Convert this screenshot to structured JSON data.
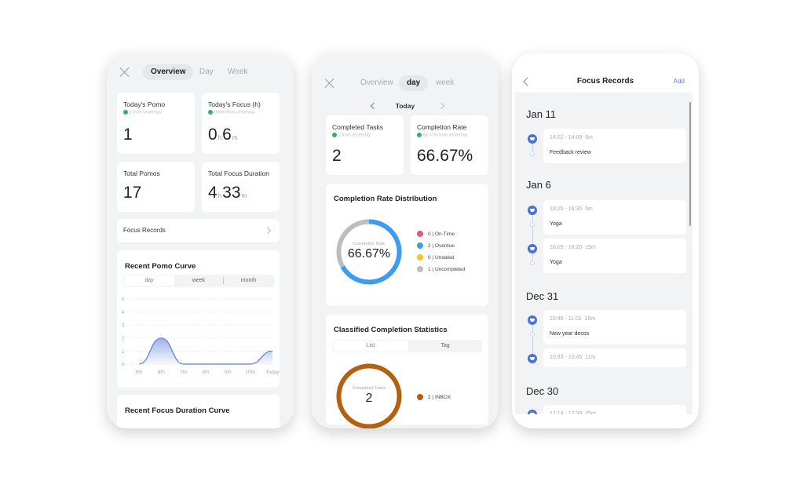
{
  "screen1": {
    "tabs": [
      "Overview",
      "Day",
      "Week"
    ],
    "active_tab": "Overview",
    "stats": [
      {
        "title": "Today's Pomo",
        "delta": "1 from yesterday",
        "value": "1"
      },
      {
        "title": "Today's Focus (h)",
        "delta": "0h6m from yesterday",
        "hours": "0",
        "minutes": "6",
        "h_unit": "h",
        "m_unit": "m"
      },
      {
        "title": "Total Pomos",
        "value": "17"
      },
      {
        "title": "Total Focus Duration",
        "hours": "4",
        "minutes": "33",
        "h_unit": "h",
        "m_unit": "m"
      }
    ],
    "focus_records_link": "Focus Records",
    "pomo_curve": {
      "title": "Recent Pomo Curve",
      "tabs": [
        "day",
        "week",
        "month"
      ],
      "active_tab": "day"
    },
    "next_section_title": "Recent Focus Duration Curve"
  },
  "chart_data": {
    "type": "area",
    "title": "Recent Pomo Curve",
    "categories": [
      "5th",
      "6th",
      "7th",
      "8th",
      "9th",
      "10th",
      "Today"
    ],
    "values": [
      0,
      2,
      0,
      0,
      0,
      0,
      1
    ],
    "yticks": [
      0,
      1,
      2,
      3,
      4,
      5
    ],
    "ylim": [
      0,
      5
    ],
    "grid": true,
    "color": "#5b7fd6"
  },
  "screen2": {
    "tabs": [
      "Overview",
      "day",
      "week"
    ],
    "active_tab": "day",
    "date_label": "Today",
    "stats": [
      {
        "title": "Completed Tasks",
        "delta": "2 from yesterday",
        "value": "2"
      },
      {
        "title": "Completion Rate",
        "delta": "66.67% from yesterday",
        "value": "66.67%"
      }
    ],
    "distribution": {
      "title": "Completion Rate Distribution",
      "center_label": "Completion Rate",
      "center_value": "66.67%",
      "legend": [
        {
          "count": "0",
          "label": "On-Time",
          "color": "#e8577a"
        },
        {
          "count": "2",
          "label": "Overdue",
          "color": "#3b9cf0"
        },
        {
          "count": "0",
          "label": "Undated",
          "color": "#f5c32c"
        },
        {
          "count": "1",
          "label": "Uncompleted",
          "color": "#bdbdbd"
        }
      ]
    },
    "classified": {
      "title": "Classified Completion Statistics",
      "tabs": [
        "List",
        "Tag"
      ],
      "active_tab": "List",
      "center_label": "Completed Tasks",
      "center_value": "2",
      "legend": [
        {
          "count": "2",
          "label": "INBOX",
          "color": "#b5600e"
        }
      ]
    }
  },
  "screen3": {
    "title": "Focus Records",
    "add_label": "Add",
    "groups": [
      {
        "date": "Jan 11",
        "records": [
          {
            "time": "14:02 - 14:09",
            "duration": "6m",
            "name": "Feedback review"
          }
        ]
      },
      {
        "date": "Jan 6",
        "records": [
          {
            "time": "16:25 - 16:30",
            "duration": "5m",
            "name": "Yoga"
          },
          {
            "time": "16:05 - 16:20",
            "duration": "15m",
            "name": "Yoga"
          }
        ]
      },
      {
        "date": "Dec 31",
        "records": [
          {
            "time": "10:46 - 11:01",
            "duration": "15m",
            "name": "New year decos"
          },
          {
            "time": "10:33 - 10:45",
            "duration": "11m",
            "name": ""
          }
        ]
      },
      {
        "date": "Dec 30",
        "records": [
          {
            "time": "17:14 - 17:39",
            "duration": "25m",
            "name": ""
          }
        ]
      }
    ]
  }
}
